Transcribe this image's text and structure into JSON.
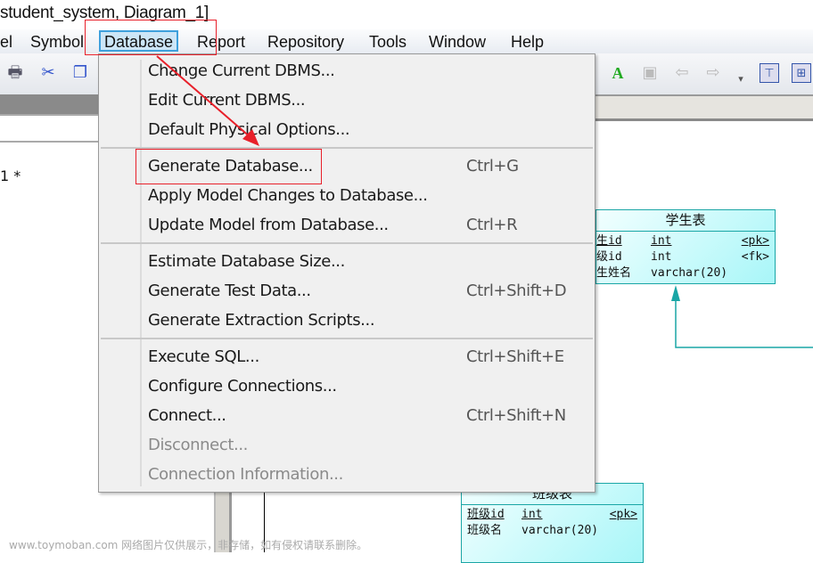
{
  "window": {
    "title": "student_system, Diagram_1]"
  },
  "menubar": [
    {
      "label": "el",
      "active": false
    },
    {
      "label": "Symbol",
      "active": false
    },
    {
      "label": "Database",
      "active": true
    },
    {
      "label": "Report",
      "active": false
    },
    {
      "label": "Repository",
      "active": false
    },
    {
      "label": "Tools",
      "active": false
    },
    {
      "label": "Window",
      "active": false
    },
    {
      "label": "Help",
      "active": false
    }
  ],
  "toolbar": {
    "icons": [
      "print-icon",
      "cut-icon",
      "copy-icon",
      "text-color-icon",
      "export-icon",
      "back-icon",
      "forward-icon",
      "overflow-icon",
      "diagram-view-icon",
      "diagram-layout-icon"
    ]
  },
  "document": {
    "tab_marker": "1 *"
  },
  "menu": {
    "groups": [
      [
        {
          "label": "Change Current DBMS...",
          "shortcut": "",
          "enabled": true
        },
        {
          "label": "Edit Current DBMS...",
          "shortcut": "",
          "enabled": true
        },
        {
          "label": "Default Physical Options...",
          "shortcut": "",
          "enabled": true
        }
      ],
      [
        {
          "label": "Generate Database...",
          "shortcut": "Ctrl+G",
          "enabled": true
        },
        {
          "label": "Apply Model Changes to Database...",
          "shortcut": "",
          "enabled": true
        },
        {
          "label": "Update Model from Database...",
          "shortcut": "Ctrl+R",
          "enabled": true
        }
      ],
      [
        {
          "label": "Estimate Database Size...",
          "shortcut": "",
          "enabled": true
        },
        {
          "label": "Generate Test Data...",
          "shortcut": "Ctrl+Shift+D",
          "enabled": true
        },
        {
          "label": "Generate Extraction Scripts...",
          "shortcut": "",
          "enabled": true
        }
      ],
      [
        {
          "label": "Execute SQL...",
          "shortcut": "Ctrl+Shift+E",
          "enabled": true
        },
        {
          "label": "Configure Connections...",
          "shortcut": "",
          "enabled": true
        },
        {
          "label": "Connect...",
          "shortcut": "Ctrl+Shift+N",
          "enabled": true
        },
        {
          "label": "Disconnect...",
          "shortcut": "",
          "enabled": false
        },
        {
          "label": "Connection Information...",
          "shortcut": "",
          "enabled": false
        }
      ]
    ]
  },
  "tables": {
    "student": {
      "name": "学生表",
      "columns": [
        {
          "name": "生id",
          "type": "int",
          "key": "<pk>",
          "pk": true
        },
        {
          "name": "级id",
          "type": "int",
          "key": "<fk>",
          "pk": false
        },
        {
          "name": "生姓名",
          "type": "varchar(20)",
          "key": "",
          "pk": false
        }
      ]
    },
    "class": {
      "name": "班级表",
      "columns": [
        {
          "name": "班级id",
          "type": "int",
          "key": "<pk>",
          "pk": true
        },
        {
          "name": "班级名",
          "type": "varchar(20)",
          "key": "",
          "pk": false
        }
      ]
    }
  },
  "colors": {
    "accent": "#3ea0dc",
    "annotation": "#e8202a",
    "entity_border": "#1aa6a6"
  },
  "watermark": "www.toymoban.com 网络图片仅供展示，非存储，如有侵权请联系删除。"
}
